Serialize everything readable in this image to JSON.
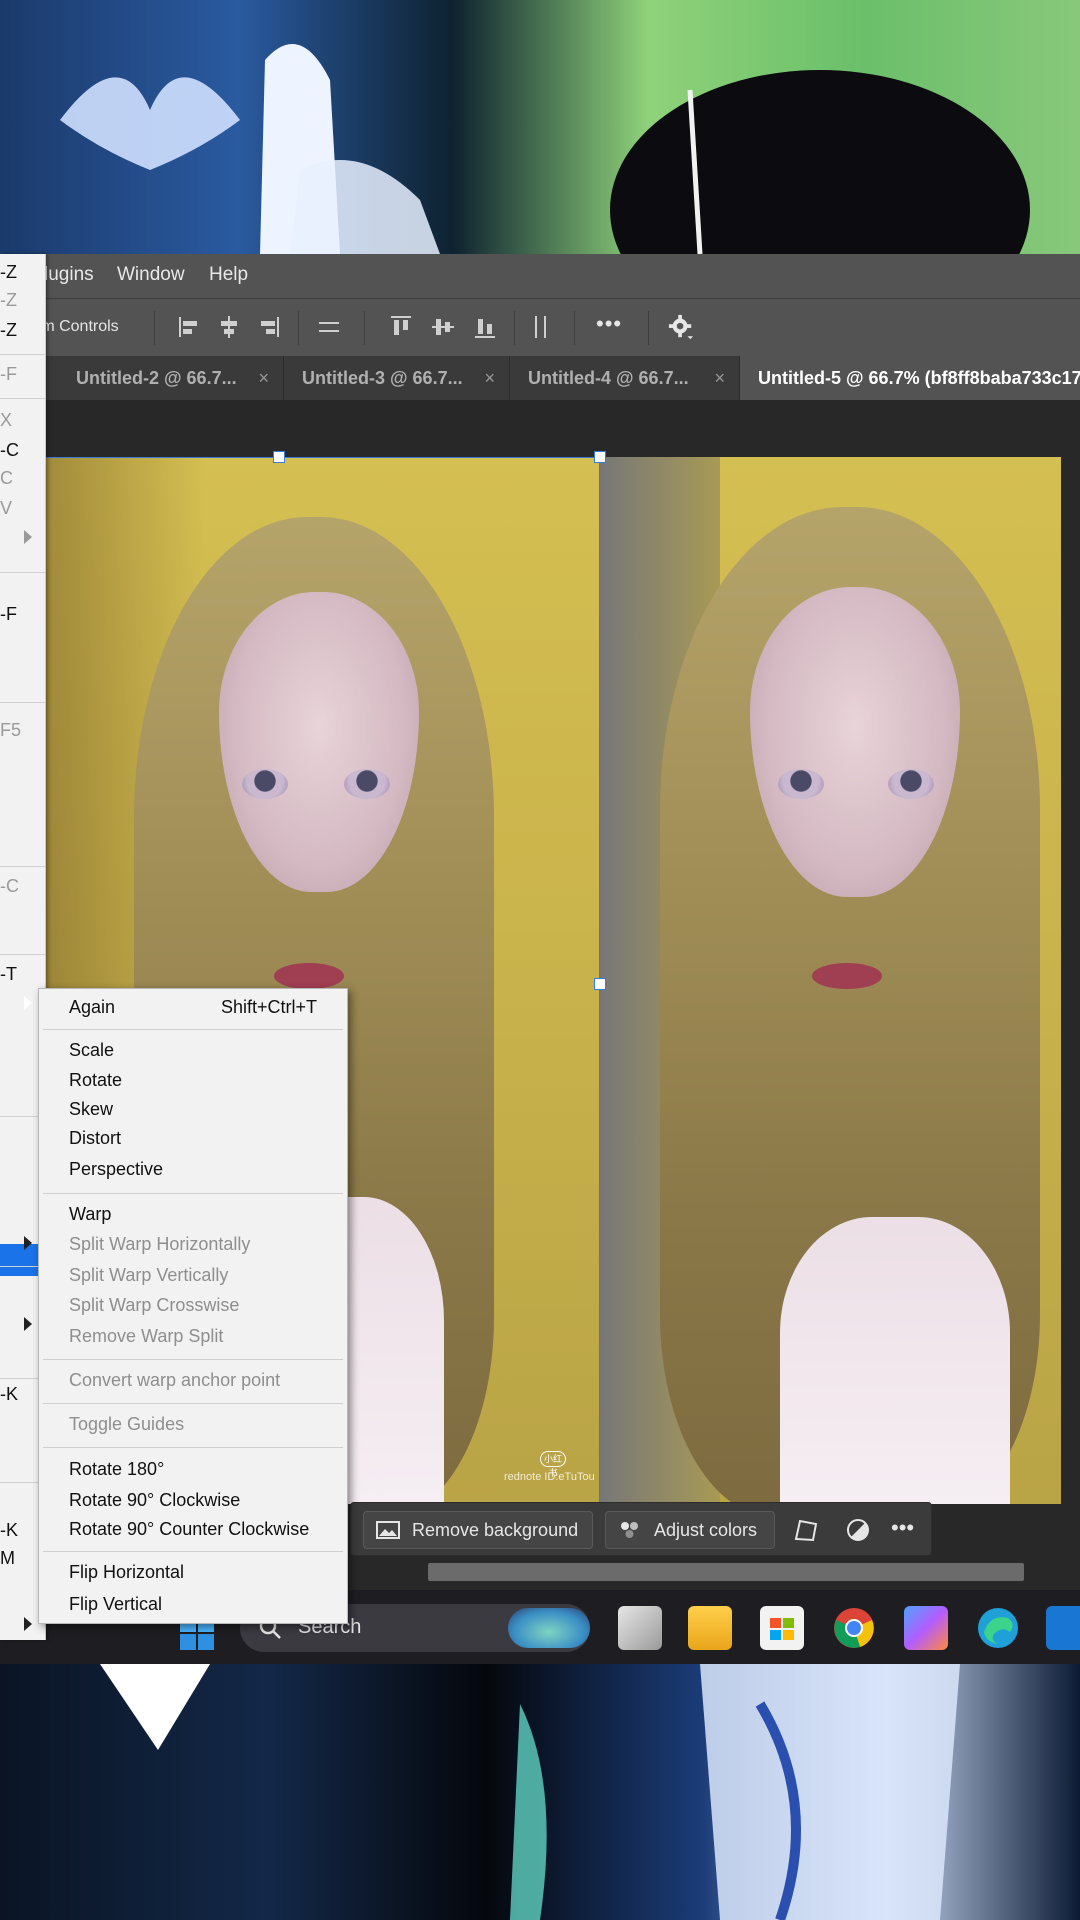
{
  "menubar": {
    "items": [
      "lugins",
      "Window",
      "Help"
    ]
  },
  "options_bar": {
    "transform_controls_label": "rm Controls",
    "more_label": "•••"
  },
  "tabs": [
    {
      "label": "Untitled-2 @ 66.7...",
      "close": "×",
      "active": false
    },
    {
      "label": "Untitled-3 @ 66.7...",
      "close": "×",
      "active": false
    },
    {
      "label": "Untitled-4 @ 66.7...",
      "close": "×",
      "active": false
    },
    {
      "label": "Untitled-5 @ 66.7% (bf8ff8baba733c17",
      "close": "",
      "active": true
    }
  ],
  "edit_menu_fragments": {
    "undo": "-Z",
    "redo": "-Z",
    "toggle": "-Z",
    "fade": "-F",
    "cut": "X",
    "copy": "-C",
    "copy_merged": "C",
    "paste": "V",
    "fill": "-F",
    "stroke": "F5",
    "content_aware": "-C",
    "free_transform": "-T",
    "color_settings": "-K",
    "keyboard": "-K",
    "menus": "M"
  },
  "transform_submenu": {
    "again": "Again",
    "again_shortcut": "Shift+Ctrl+T",
    "scale": "Scale",
    "rotate": "Rotate",
    "skew": "Skew",
    "distort": "Distort",
    "perspective": "Perspective",
    "warp": "Warp",
    "split_warp_h": "Split Warp Horizontally",
    "split_warp_v": "Split Warp Vertically",
    "split_warp_cross": "Split Warp Crosswise",
    "remove_warp_split": "Remove Warp Split",
    "convert_warp_anchor": "Convert warp anchor point",
    "toggle_guides": "Toggle Guides",
    "rotate_180": "Rotate 180°",
    "rotate_90_cw": "Rotate 90° Clockwise",
    "rotate_90_ccw": "Rotate 90° Counter Clockwise",
    "flip_h": "Flip Horizontal",
    "flip_v": "Flip Vertical"
  },
  "contextual_taskbar": {
    "remove_background": "Remove background",
    "adjust_colors": "Adjust colors",
    "more": "•••"
  },
  "watermark": {
    "line1": "小红书",
    "line2": "rednote ID:eTuTou"
  },
  "windows_taskbar": {
    "search_placeholder": "Search"
  },
  "colors": {
    "menu_highlight": "#1a73e8",
    "panel_bg": "#535353",
    "canvas_bg": "#282828"
  }
}
